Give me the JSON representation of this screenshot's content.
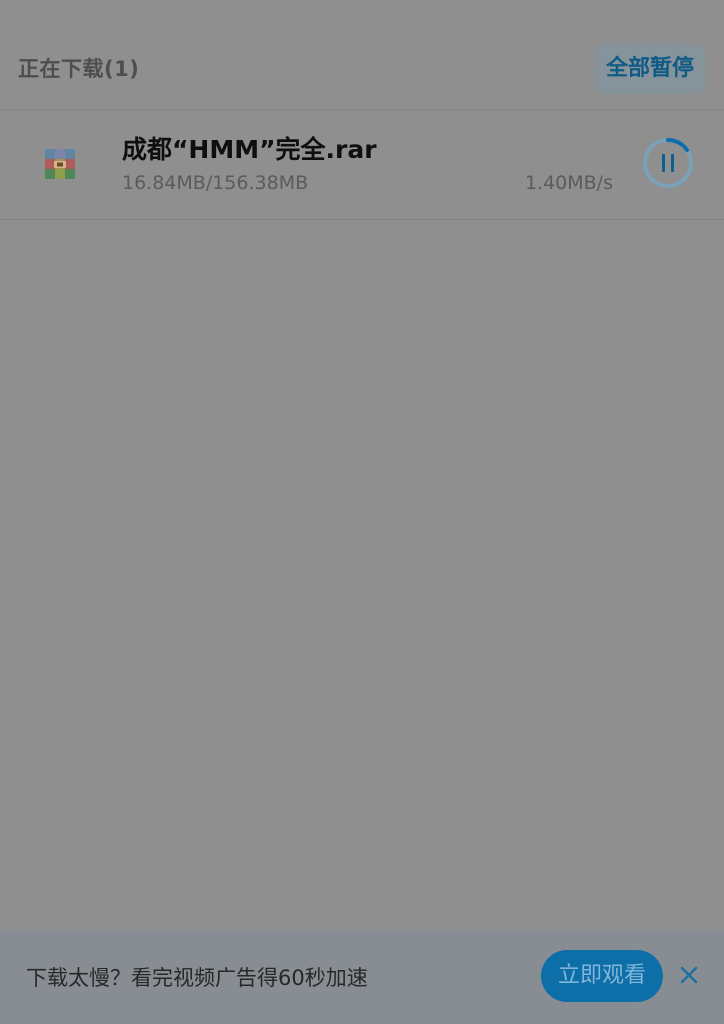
{
  "downloads": {
    "section_title": "正在下载(1)",
    "pause_all_label": "全部暂停",
    "items": [
      {
        "file_name": "成都“HMM”完全.rar",
        "file_size": "16.84MB/156.38MB",
        "speed": "1.40MB/s",
        "icon_name": "archive-file-icon",
        "control_icon_name": "pause-icon"
      }
    ]
  },
  "banner": {
    "text": "下载太慢？看完视频广告得60秒加速",
    "watch_label": "立即观看",
    "close_icon_name": "close-icon"
  },
  "colors": {
    "accent": "#0E6EA8",
    "overlay": "#8F8F8F"
  }
}
